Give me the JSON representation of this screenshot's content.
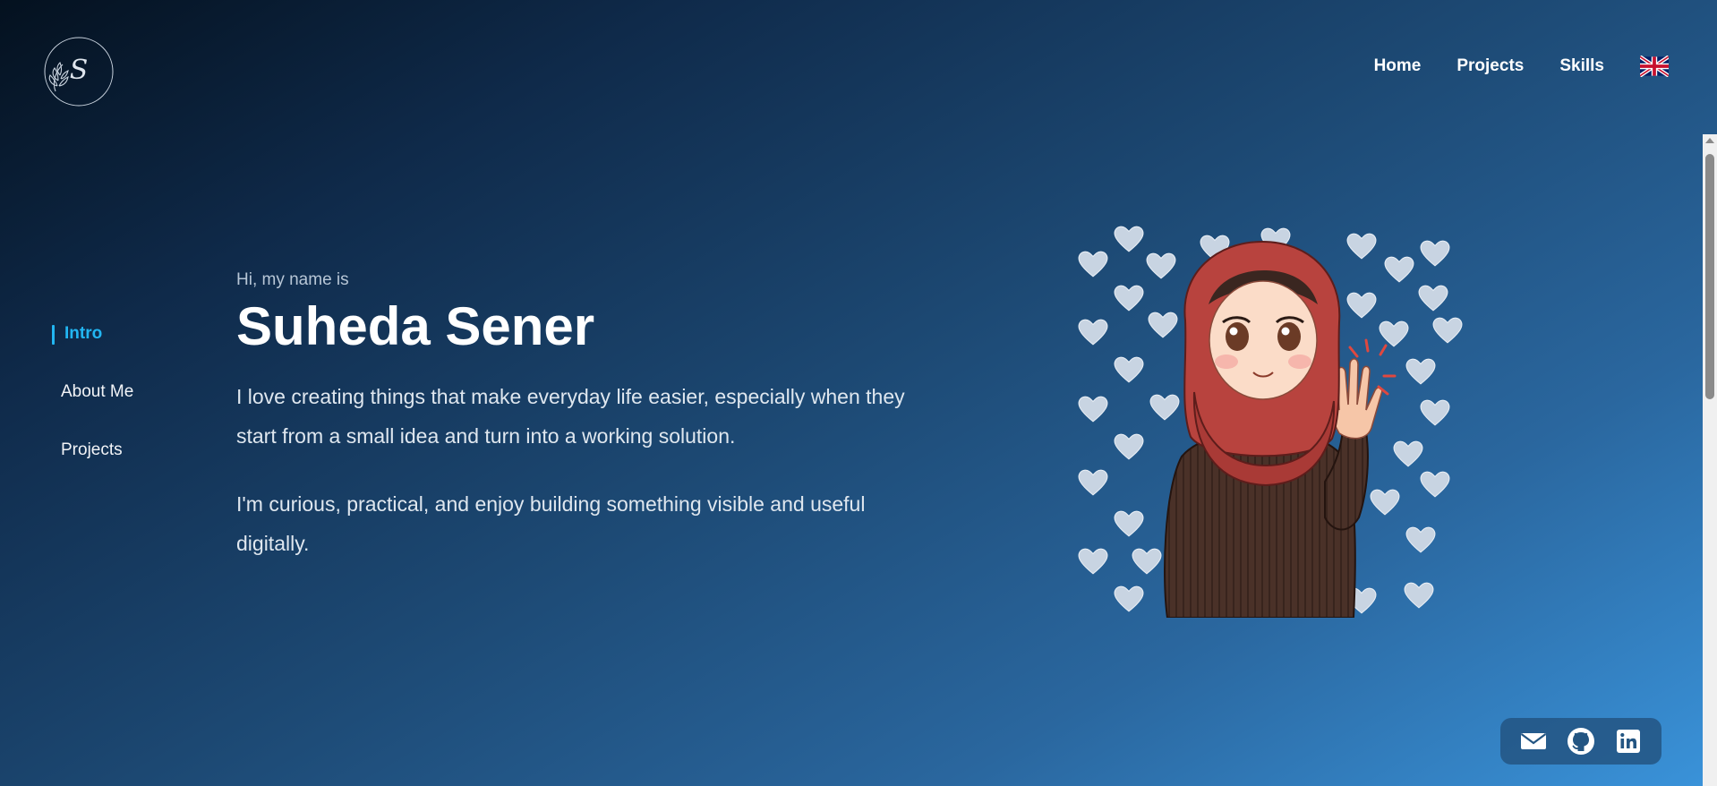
{
  "brand": {
    "logo_letter": "S",
    "logo_icon": "signature-monogram-logo"
  },
  "top_nav": {
    "items": [
      "Home",
      "Projects",
      "Skills"
    ],
    "language_icon": "uk-flag-icon"
  },
  "side_nav": {
    "items": [
      "Intro",
      "About Me",
      "Projects"
    ],
    "active": "Intro"
  },
  "intro": {
    "greeting": "Hi, my name is",
    "name": "Suheda Sener",
    "paragraph_1": "I love creating things that make everyday life easier, especially when they start from a small idea and turn into a working solution.",
    "paragraph_2": "I'm curious, practical, and enjoy building something visible and useful digitally."
  },
  "avatar": {
    "icon": "waving-girl-illustration"
  },
  "social": {
    "icons": [
      "mail-icon",
      "github-icon",
      "linkedin-icon"
    ]
  },
  "colors": {
    "accent": "#22b6f2",
    "background_start": "#04111f",
    "background_end": "#3a93da"
  }
}
